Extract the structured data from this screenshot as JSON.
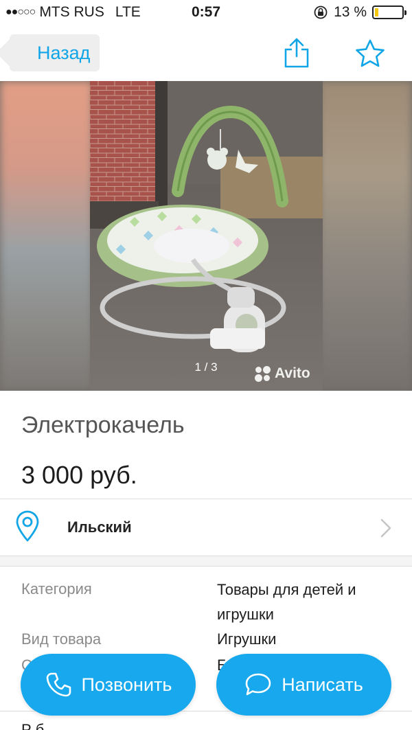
{
  "status_bar": {
    "signal": "●●○○○",
    "carrier": "MTS RUS",
    "network": "LTE",
    "time": "0:57",
    "battery_text": "13 %",
    "battery_level": 0.13,
    "battery_color": "#f6c90e"
  },
  "nav": {
    "back_label": "Назад",
    "share_icon": "share-icon",
    "favorite_icon": "star-icon",
    "accent_color": "#0fa5e6"
  },
  "gallery": {
    "counter": "1 / 3",
    "watermark": "Avito"
  },
  "listing": {
    "title": "Электрокачель",
    "price": "3 000 руб.",
    "location": "Ильский"
  },
  "params": [
    {
      "label": "Категория",
      "value": "Товары для детей и игрушки"
    },
    {
      "label": "Вид товара",
      "value": "Игрушки"
    },
    {
      "label": "С",
      "value": "Б"
    }
  ],
  "description_peek": "Р                                                       б",
  "actions": {
    "call_label": "Позвонить",
    "message_label": "Написать",
    "button_color": "#17a8ee"
  }
}
